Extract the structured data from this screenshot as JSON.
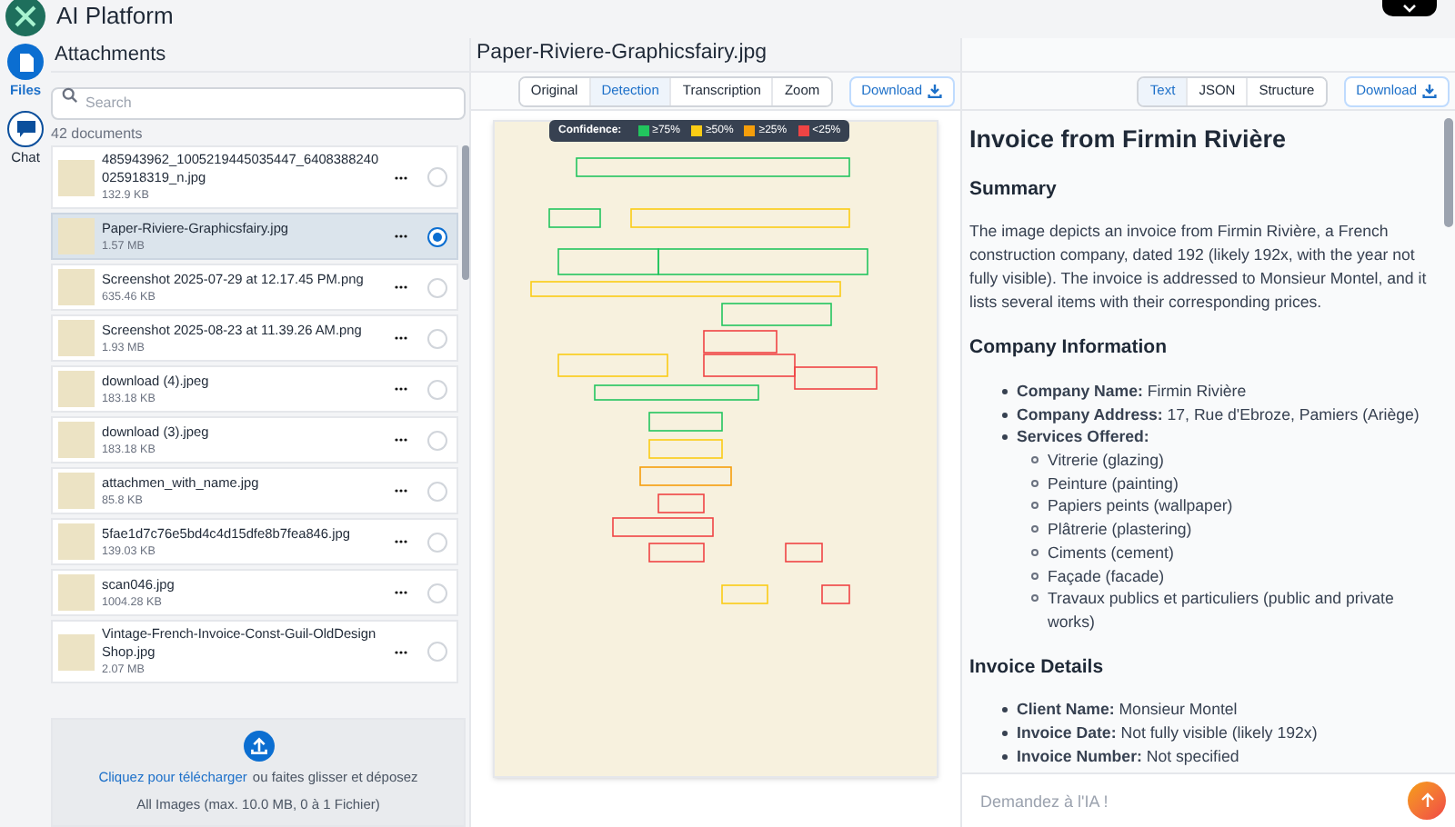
{
  "app": {
    "title": "AI Platform"
  },
  "nav": [
    {
      "label": "Files",
      "selected": true
    },
    {
      "label": "Chat",
      "selected": false
    }
  ],
  "attachments": {
    "title": "Attachments",
    "search": {
      "placeholder": "Search"
    },
    "count": "42 documents",
    "files": [
      {
        "name": "485943962_1005219445035447_6408388240025918319_n.jpg",
        "size": "132.9 KB",
        "selected": false
      },
      {
        "name": "Paper-Riviere-Graphicsfairy.jpg",
        "size": "1.57 MB",
        "selected": true
      },
      {
        "name": "Screenshot 2025-07-29 at 12.17.45 PM.png",
        "size": "635.46 KB",
        "selected": false
      },
      {
        "name": "Screenshot 2025-08-23 at 11.39.26 AM.png",
        "size": "1.93 MB",
        "selected": false
      },
      {
        "name": "download (4).jpeg",
        "size": "183.18 KB",
        "selected": false
      },
      {
        "name": "download (3).jpeg",
        "size": "183.18 KB",
        "selected": false
      },
      {
        "name": "attachmen_with_name.jpg",
        "size": "85.8 KB",
        "selected": false
      },
      {
        "name": "5fae1d7c76e5bd4c4d15dfe8b7fea846.jpg",
        "size": "139.03 KB",
        "selected": false
      },
      {
        "name": "scan046.jpg",
        "size": "1004.28 KB",
        "selected": false
      },
      {
        "name": "Vintage-French-Invoice-Const-Guil-OldDesignShop.jpg",
        "size": "2.07 MB",
        "selected": false
      }
    ],
    "upload": {
      "link": "Cliquez pour télécharger",
      "text": "ou faites glisser et déposez",
      "hint": "All Images (max. 10.0 MB, 0 à 1 Fichier)"
    }
  },
  "viewer": {
    "title": "Paper-Riviere-Graphicsfairy.jpg",
    "tabs": [
      {
        "label": "Original",
        "selected": false
      },
      {
        "label": "Detection",
        "selected": true
      },
      {
        "label": "Transcription",
        "selected": false
      },
      {
        "label": "Zoom",
        "selected": false
      }
    ],
    "download": "Download",
    "legend": {
      "label": "Confidence:",
      "items": [
        {
          "label": "≥75%",
          "color": "#22c55e"
        },
        {
          "label": "≥50%",
          "color": "#facc15"
        },
        {
          "label": "≥25%",
          "color": "#f59e0b"
        },
        {
          "label": "<25%",
          "color": "#ef4444"
        }
      ]
    }
  },
  "result": {
    "tabs": [
      {
        "label": "Text",
        "selected": true
      },
      {
        "label": "JSON",
        "selected": false
      },
      {
        "label": "Structure",
        "selected": false
      }
    ],
    "download": "Download",
    "blocks": [
      {
        "kind": "h1",
        "text": "Invoice from Firmin Rivière"
      },
      {
        "kind": "h2",
        "text": "Summary"
      },
      {
        "kind": "p",
        "text": "The image depicts an invoice from Firmin Rivière, a French construction company, dated 192 (likely 192x, with the year not fully visible). The invoice is addressed to Monsieur Montel, and it lists several items with their corresponding prices."
      },
      {
        "kind": "h2",
        "text": "Company Information"
      },
      {
        "kind": "ul",
        "items": [
          {
            "text": "**Company Name:** Firmin Rivière"
          },
          {
            "text": "**Company Address:** 17, Rue d'Ebroze, Pamiers (Ariège)"
          },
          {
            "text": "**Services Offered:**",
            "children": [
              {
                "text": "Vitrerie (glazing)"
              },
              {
                "text": "Peinture (painting)"
              },
              {
                "text": "Papiers peints (wallpaper)"
              },
              {
                "text": "Plâtrerie (plastering)"
              },
              {
                "text": "Ciments (cement)"
              },
              {
                "text": "Façade (facade)"
              },
              {
                "text": "Travaux publics et particuliers (public and private works)"
              }
            ]
          }
        ]
      },
      {
        "kind": "h2",
        "text": "Invoice Details"
      },
      {
        "kind": "ul",
        "items": [
          {
            "text": "**Client Name:** Monsieur Montel"
          },
          {
            "text": "**Invoice Date:** Not fully visible (likely 192x)"
          },
          {
            "text": "**Invoice Number:** Not specified"
          }
        ]
      }
    ]
  },
  "chat": {
    "placeholder": "Demandez à l'IA !"
  }
}
